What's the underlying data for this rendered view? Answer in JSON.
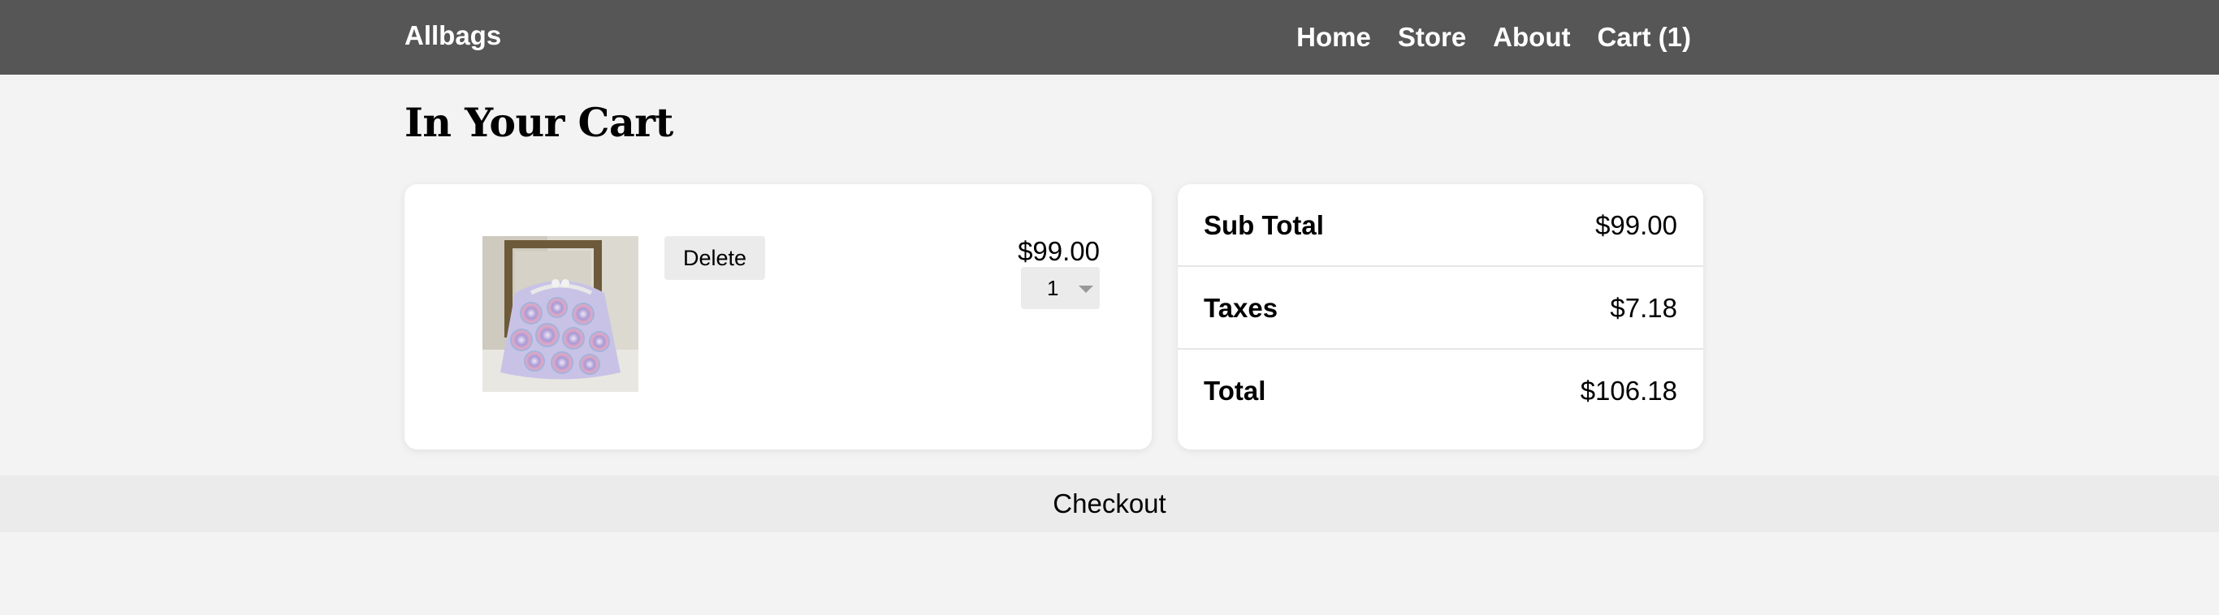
{
  "navbar": {
    "brand": "Allbags",
    "links": [
      {
        "label": "Home"
      },
      {
        "label": "Store"
      },
      {
        "label": "About"
      },
      {
        "label": "Cart (1)"
      }
    ]
  },
  "page": {
    "title": "In Your Cart"
  },
  "cart": {
    "items": [
      {
        "image_alt": "handbag-photo",
        "delete_label": "Delete",
        "price": "$99.00",
        "quantity": "1"
      }
    ]
  },
  "summary": {
    "rows": [
      {
        "label": "Sub Total",
        "value": "$99.00"
      },
      {
        "label": "Taxes",
        "value": "$7.18"
      },
      {
        "label": "Total",
        "value": "$106.18"
      }
    ]
  },
  "checkout": {
    "label": "Checkout"
  },
  "colors": {
    "navbar_bg": "#565656",
    "page_bg": "#f3f3f3",
    "card_bg": "#ffffff",
    "button_bg": "#ebebeb"
  }
}
